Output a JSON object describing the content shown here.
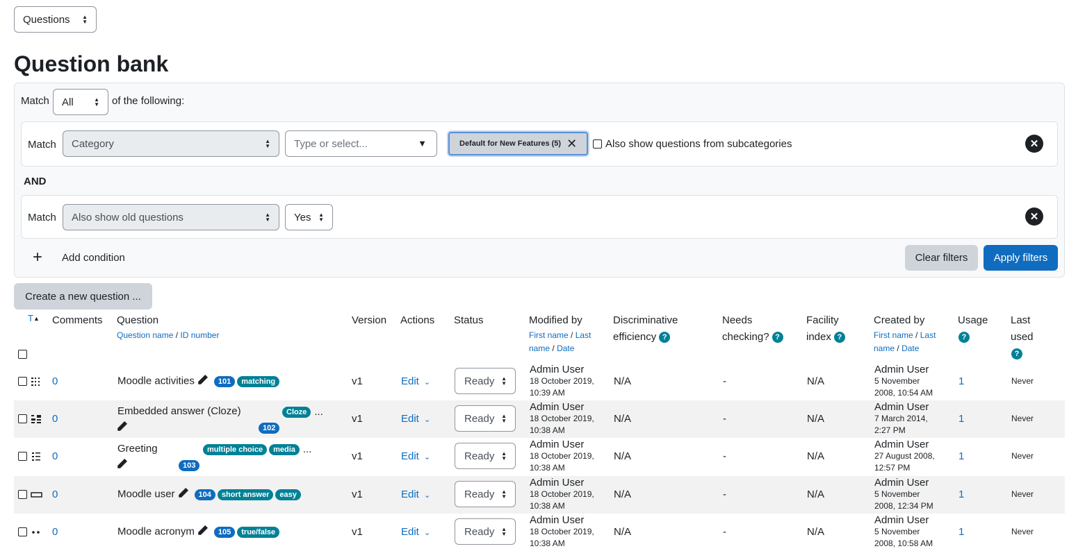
{
  "top_select": "Questions",
  "page_title": "Question bank",
  "filters": {
    "match_label": "Match",
    "match_value": "All",
    "of_following": "of the following:",
    "condition1": {
      "match_label": "Match",
      "type": "Category",
      "search_placeholder": "Type or select...",
      "chip": "Default for New Features (5)",
      "subcategories_label": "Also show questions from subcategories"
    },
    "and_label": "AND",
    "condition2": {
      "match_label": "Match",
      "type": "Also show old questions",
      "value": "Yes"
    },
    "add_condition": "Add condition",
    "clear": "Clear filters",
    "apply": "Apply filters"
  },
  "create_button": "Create a new question ...",
  "table": {
    "headers": {
      "type": "T",
      "comments": "Comments",
      "question": "Question",
      "question_sub1": "Question name",
      "question_sub2": "ID number",
      "version": "Version",
      "actions": "Actions",
      "status": "Status",
      "modified_by": "Modified by",
      "modified_sub1": "First name",
      "modified_sub2": "Last",
      "modified_sub3": "name",
      "modified_sub4": "Date",
      "disc1": "Discriminative",
      "disc2": "efficiency",
      "needs1": "Needs",
      "needs2": "checking?",
      "facility1": "Facility",
      "facility2": "index",
      "created_by": "Created by",
      "created_sub1": "First name",
      "created_sub2": "Last",
      "created_sub3": "name",
      "created_sub4": "Date",
      "usage": "Usage",
      "last1": "Last",
      "last2": "used"
    },
    "rows": [
      {
        "comments": "0",
        "name": "Moodle activities",
        "id": "101",
        "tags": [
          "matching"
        ],
        "more": "",
        "version": "v1",
        "edit": "Edit",
        "status": "Ready",
        "mod_user": "Admin User",
        "mod_date1": "18 October 2019,",
        "mod_date2": "10:39 AM",
        "disc": "N/A",
        "needs": "-",
        "facility": "N/A",
        "cre_user": "Admin User",
        "cre_date1": "5 November",
        "cre_date2": "2008, 10:54 AM",
        "usage": "1",
        "last": "Never"
      },
      {
        "comments": "0",
        "name": "Embedded answer (Cloze)",
        "id": "102",
        "tags": [
          "Cloze"
        ],
        "more": "...",
        "version": "v1",
        "edit": "Edit",
        "status": "Ready",
        "mod_user": "Admin User",
        "mod_date1": "18 October 2019,",
        "mod_date2": "10:38 AM",
        "disc": "N/A",
        "needs": "-",
        "facility": "N/A",
        "cre_user": "Admin User",
        "cre_date1": "7 March 2014,",
        "cre_date2": "2:27 PM",
        "usage": "1",
        "last": "Never"
      },
      {
        "comments": "0",
        "name": "Greeting",
        "id": "103",
        "tags": [
          "multiple choice",
          "media"
        ],
        "more": "...",
        "version": "v1",
        "edit": "Edit",
        "status": "Ready",
        "mod_user": "Admin User",
        "mod_date1": "18 October 2019,",
        "mod_date2": "10:38 AM",
        "disc": "N/A",
        "needs": "-",
        "facility": "N/A",
        "cre_user": "Admin User",
        "cre_date1": "27 August 2008,",
        "cre_date2": "12:57 PM",
        "usage": "1",
        "last": "Never"
      },
      {
        "comments": "0",
        "name": "Moodle user",
        "id": "104",
        "tags": [
          "short answer",
          "easy"
        ],
        "more": "",
        "version": "v1",
        "edit": "Edit",
        "status": "Ready",
        "mod_user": "Admin User",
        "mod_date1": "18 October 2019,",
        "mod_date2": "10:38 AM",
        "disc": "N/A",
        "needs": "-",
        "facility": "N/A",
        "cre_user": "Admin User",
        "cre_date1": "5 November",
        "cre_date2": "2008, 12:34 PM",
        "usage": "1",
        "last": "Never"
      },
      {
        "comments": "0",
        "name": "Moodle acronym",
        "id": "105",
        "tags": [
          "true/false"
        ],
        "more": "",
        "version": "v1",
        "edit": "Edit",
        "status": "Ready",
        "mod_user": "Admin User",
        "mod_date1": "18 October 2019,",
        "mod_date2": "10:38 AM",
        "disc": "N/A",
        "needs": "-",
        "facility": "N/A",
        "cre_user": "Admin User",
        "cre_date1": "5 November",
        "cre_date2": "2008, 10:58 AM",
        "usage": "1",
        "last": "Never"
      }
    ]
  },
  "colors": {
    "primary": "#0f6cbf",
    "teal": "#008196",
    "secondary": "#ced4da"
  }
}
